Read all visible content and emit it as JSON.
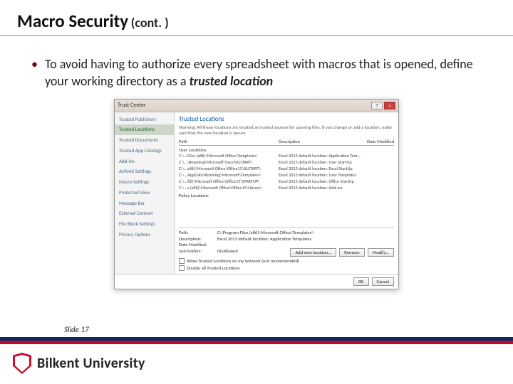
{
  "slide": {
    "title": "Macro Security",
    "title_suffix": "(cont. )",
    "bullet_prefix": "To avoid having to authorize every spreadsheet with macros that is opened, define your working directory as a ",
    "bullet_emph": "trusted location",
    "slide_number": "Slide 17",
    "university": "Bilkent University"
  },
  "dialog": {
    "window_title": "Trust Center",
    "sidebar": [
      "Trusted Publishers",
      "Trusted Locations",
      "Trusted Documents",
      "Trusted App Catalogs",
      "Add-ins",
      "ActiveX Settings",
      "Macro Settings",
      "Protected View",
      "Message Bar",
      "External Content",
      "File Block Settings",
      "Privacy Options"
    ],
    "panel_heading": "Trusted Locations",
    "warning": "Warning: All these locations are treated as trusted sources for opening files. If you change or add a location, make sure that the new location is secure.",
    "col_path": "Path",
    "col_desc": "Description",
    "col_date": "Date Modified",
    "group_user": "User Locations",
    "rows": [
      {
        "path": "C:\\...Files (x86)\\Microsoft Office\\Templates\\",
        "desc": "Excel 2013 default location: Application Tem..."
      },
      {
        "path": "C:\\...\\Roaming\\Microsoft\\Excel\\XLSTART\\",
        "desc": "Excel 2013 default location: User StartUp"
      },
      {
        "path": "C:\\...x86)\\Microsoft Office\\Office15\\XLSTART\\",
        "desc": "Excel 2013 default location: Excel StartUp"
      },
      {
        "path": "C:\\...AppData\\Roaming\\Microsoft\\Templates\\",
        "desc": "Excel 2013 default location: User Templates"
      },
      {
        "path": "C:\\...86)\\Microsoft Office\\Office15\\STARTUP\\",
        "desc": "Excel 2013 default location: Office StartUp"
      },
      {
        "path": "C:\\...s (x86)\\Microsoft Office\\Office15\\Library\\",
        "desc": "Excel 2013 default location: Add-ins"
      }
    ],
    "group_policy": "Policy Locations",
    "details": {
      "path_label": "Path:",
      "path_value": "C:\\Program Files (x86)\\Microsoft Office\\Templates\\",
      "desc_label": "Description:",
      "desc_value": "Excel 2013 default location: Application Templates",
      "date_label": "Date Modified:",
      "date_value": "",
      "sub_label": "Sub Folders:",
      "sub_value": "Disallowed"
    },
    "buttons": {
      "add": "Add new location...",
      "remove": "Remove",
      "modify": "Modify..."
    },
    "checks": {
      "allow_network": "Allow Trusted Locations on my network (not recommended)",
      "disable_all": "Disable all Trusted Locations"
    },
    "footer": {
      "ok": "OK",
      "cancel": "Cancel"
    }
  }
}
